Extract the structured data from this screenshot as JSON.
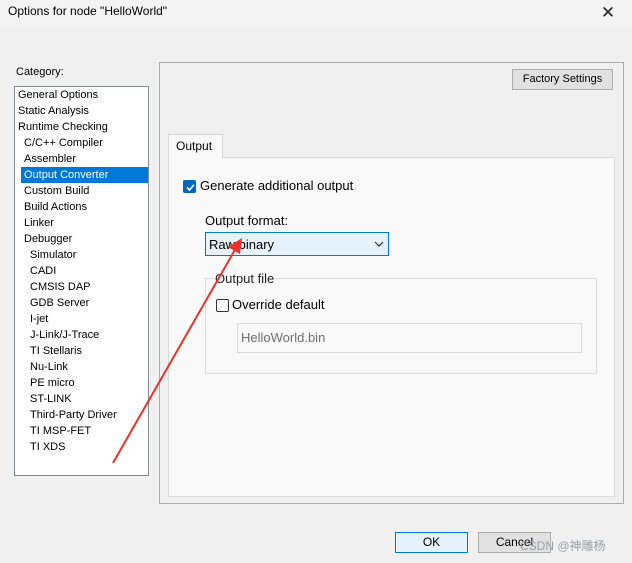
{
  "window": {
    "title": "Options for node \"HelloWorld\"",
    "close_glyph": "✕"
  },
  "category": {
    "label": "Category:",
    "items": [
      {
        "label": "General Options",
        "level": 0
      },
      {
        "label": "Static Analysis",
        "level": 0
      },
      {
        "label": "Runtime Checking",
        "level": 0
      },
      {
        "label": "C/C++ Compiler",
        "level": 1
      },
      {
        "label": "Assembler",
        "level": 1
      },
      {
        "label": "Output Converter",
        "level": 1,
        "selected": true
      },
      {
        "label": "Custom Build",
        "level": 1
      },
      {
        "label": "Build Actions",
        "level": 1
      },
      {
        "label": "Linker",
        "level": 1
      },
      {
        "label": "Debugger",
        "level": 1
      },
      {
        "label": "Simulator",
        "level": 2
      },
      {
        "label": "CADI",
        "level": 2
      },
      {
        "label": "CMSIS DAP",
        "level": 2
      },
      {
        "label": "GDB Server",
        "level": 2
      },
      {
        "label": "I-jet",
        "level": 2
      },
      {
        "label": "J-Link/J-Trace",
        "level": 2
      },
      {
        "label": "TI Stellaris",
        "level": 2
      },
      {
        "label": "Nu-Link",
        "level": 2
      },
      {
        "label": "PE micro",
        "level": 2
      },
      {
        "label": "ST-LINK",
        "level": 2
      },
      {
        "label": "Third-Party Driver",
        "level": 2
      },
      {
        "label": "TI MSP-FET",
        "level": 2
      },
      {
        "label": "TI XDS",
        "level": 2
      }
    ]
  },
  "panel": {
    "factory_settings_label": "Factory Settings",
    "tabs": [
      {
        "label": "Output"
      }
    ],
    "generate_output": {
      "label": "Generate additional output",
      "checked": true
    },
    "output_format": {
      "label": "Output format:",
      "value": "Raw binary"
    },
    "output_file": {
      "group_label": "Output file",
      "override_default": {
        "label": "Override default",
        "checked": false
      },
      "path_value": "HelloWorld.bin"
    }
  },
  "footer": {
    "ok_label": "OK",
    "cancel_label": "Cancel"
  },
  "watermark": "CSDN @神雕杨",
  "colors": {
    "accent": "#0078d7",
    "annotation_arrow": "#e8322b"
  }
}
